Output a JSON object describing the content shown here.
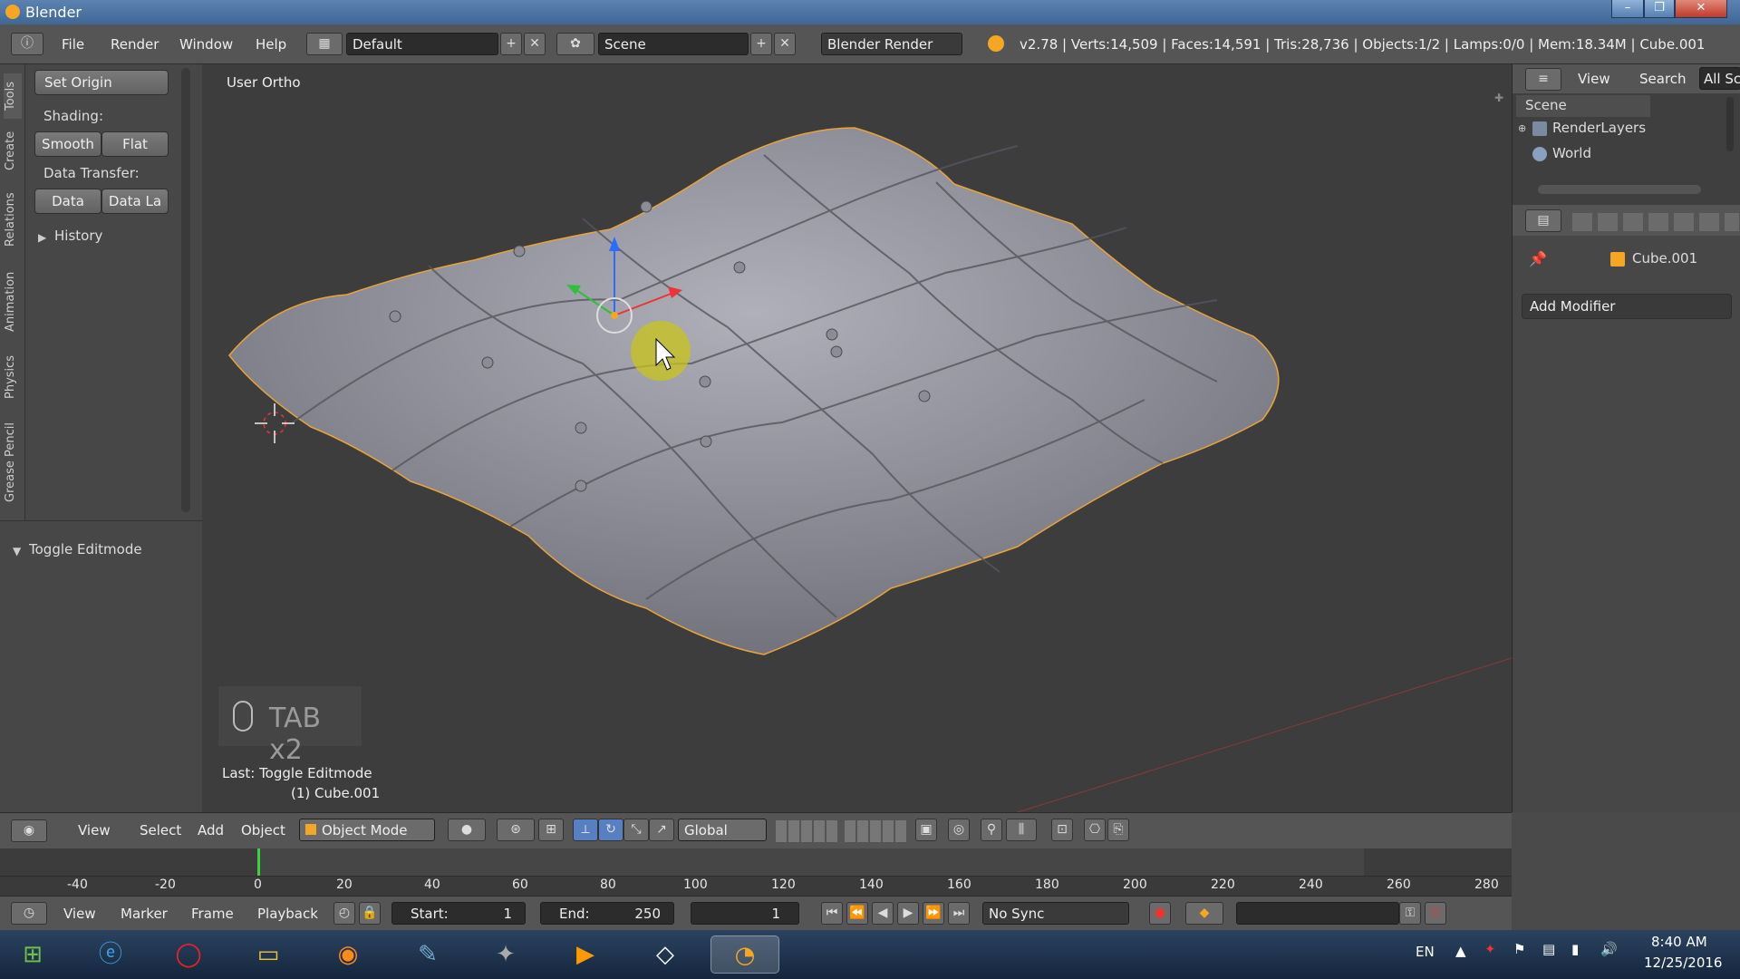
{
  "window": {
    "title": "Blender",
    "min": "–",
    "max": "❐",
    "close": "✕"
  },
  "header": {
    "menus": [
      "File",
      "Render",
      "Window",
      "Help"
    ],
    "layout": "Default",
    "scene": "Scene",
    "engine": "Blender Render",
    "stats": "v2.78 | Verts:14,509 | Faces:14,591 | Tris:28,736 | Objects:1/2 | Lamps:0/0 | Mem:18.34M | Cube.001"
  },
  "tabs": [
    "Tools",
    "Create",
    "Relations",
    "Animation",
    "Physics",
    "Grease Pencil"
  ],
  "toolshelf": {
    "set_origin": "Set Origin",
    "shading_label": "Shading:",
    "smooth": "Smooth",
    "flat": "Flat",
    "data_transfer_label": "Data Transfer:",
    "data": "Data",
    "data_la": "Data La",
    "history": "History"
  },
  "operator_panel": {
    "title": "Toggle Editmode"
  },
  "viewport": {
    "view_name": "User Ortho",
    "keypress": "TAB x2",
    "last_op": "Last: Toggle Editmode",
    "object_info": "(1) Cube.001"
  },
  "outliner": {
    "view": "View",
    "search": "Search",
    "filter": "All Sc",
    "items": [
      "Scene",
      "RenderLayers",
      "World"
    ]
  },
  "properties": {
    "object": "Cube.001",
    "add_modifier": "Add Modifier"
  },
  "viewport_header": {
    "menus": [
      "View",
      "Select",
      "Add",
      "Object"
    ],
    "mode": "Object Mode",
    "orientation": "Global"
  },
  "timeline": {
    "ticks": [
      "-40",
      "-20",
      "0",
      "20",
      "40",
      "60",
      "80",
      "100",
      "120",
      "140",
      "160",
      "180",
      "200",
      "220",
      "240",
      "260",
      "280"
    ],
    "menus": [
      "View",
      "Marker",
      "Frame",
      "Playback"
    ],
    "start_label": "Start:",
    "start": "1",
    "end_label": "End:",
    "end": "250",
    "current": "1",
    "sync": "No Sync"
  },
  "taskbar": {
    "lang": "EN",
    "time": "8:40 AM",
    "date": "12/25/2016"
  },
  "colors": {
    "accent": "#f5a623",
    "selection_outline": "#e8a33a",
    "mesh": "#8a8a95"
  }
}
